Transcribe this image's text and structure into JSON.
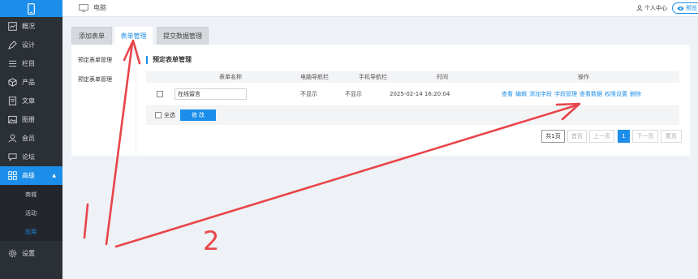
{
  "sidebar": {
    "items": [
      {
        "label": "概况",
        "icon": "chart-icon"
      },
      {
        "label": "设计",
        "icon": "design-icon"
      },
      {
        "label": "栏目",
        "icon": "list-icon"
      },
      {
        "label": "产品",
        "icon": "cube-icon"
      },
      {
        "label": "文章",
        "icon": "article-icon"
      },
      {
        "label": "图册",
        "icon": "image-icon"
      },
      {
        "label": "会员",
        "icon": "user-icon"
      },
      {
        "label": "论坛",
        "icon": "chat-icon"
      },
      {
        "label": "高级",
        "icon": "grid-icon",
        "active": true
      }
    ],
    "sub_items": [
      {
        "label": "商城"
      },
      {
        "label": "活动"
      },
      {
        "label": "应用",
        "active": true
      }
    ],
    "settings_label": "设置"
  },
  "header": {
    "device_label": "电脑",
    "user_center": "个人中心",
    "preview": "预览"
  },
  "tabs": [
    {
      "label": "添加表单"
    },
    {
      "label": "表单管理",
      "active": true
    },
    {
      "label": "提交数据管理"
    }
  ],
  "left_menu": [
    {
      "label": "预定表单管理"
    },
    {
      "label": "预定表单管理",
      "active": true
    }
  ],
  "section_title": "预定表单管理",
  "table": {
    "headers": [
      "表单名称",
      "电脑导航栏",
      "手机导航栏",
      "时间",
      "操作"
    ],
    "rows": [
      {
        "name": "在线留言",
        "pc_nav": "不显示",
        "mobile_nav": "不显示",
        "time": "2025-02-14 16:20:04",
        "actions": [
          "查看",
          "编辑",
          "添加字段",
          "字段管理",
          "查看数据",
          "权限设置",
          "删除"
        ]
      }
    ]
  },
  "footer": {
    "select_all": "全选",
    "modify": "修 改"
  },
  "pagination": {
    "total": "共1页",
    "first": "首页",
    "prev": "上一页",
    "current": "1",
    "next": "下一页",
    "last": "尾页"
  },
  "annotations": {
    "color": "#e8454a",
    "labels": [
      "1",
      "2"
    ]
  },
  "colors": {
    "accent": "#1c8ee9",
    "sidebar_bg": "#2b2f36"
  }
}
